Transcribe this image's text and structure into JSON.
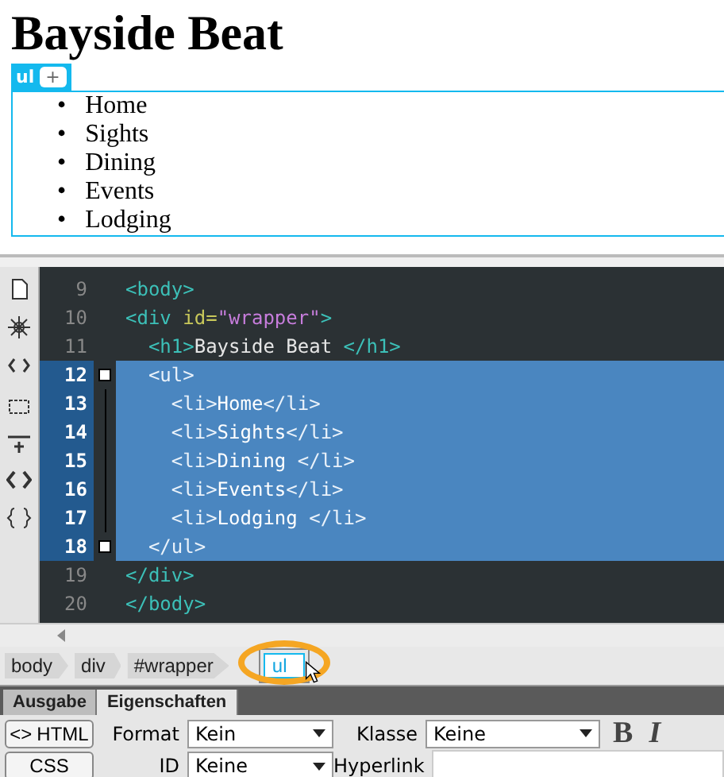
{
  "design_view": {
    "heading": "Bayside Beat",
    "tag_badge": {
      "label": "ul",
      "add": "+"
    },
    "list_items": [
      {
        "marker": "•",
        "text": "Home"
      },
      {
        "marker": "•",
        "text": "Sights"
      },
      {
        "marker": "•",
        "text": "Dining"
      },
      {
        "marker": "•",
        "text": "Events"
      },
      {
        "marker": "•",
        "text": "Lodging"
      }
    ]
  },
  "code_view": {
    "lines": [
      {
        "number": "9",
        "selected": false,
        "fold": false,
        "tokens": [
          {
            "kind": "tag",
            "text": "<body>"
          }
        ]
      },
      {
        "number": "10",
        "selected": false,
        "fold": false,
        "tokens": [
          {
            "kind": "tag",
            "text": "<div "
          },
          {
            "kind": "attr",
            "text": "id="
          },
          {
            "kind": "value",
            "text": "\"wrapper\""
          },
          {
            "kind": "tag",
            "text": ">"
          }
        ]
      },
      {
        "number": "11",
        "selected": false,
        "fold": false,
        "tokens": [
          {
            "kind": "tag",
            "text": "  <h1>"
          },
          {
            "kind": "text",
            "text": "Bayside Beat "
          },
          {
            "kind": "tag",
            "text": "</h1>"
          }
        ]
      },
      {
        "number": "12",
        "selected": true,
        "fold": true,
        "tokens": [
          {
            "kind": "tag",
            "text": "  <ul>"
          }
        ]
      },
      {
        "number": "13",
        "selected": true,
        "fold": false,
        "tokens": [
          {
            "kind": "tag",
            "text": "    <li>"
          },
          {
            "kind": "text",
            "text": "Home"
          },
          {
            "kind": "tag",
            "text": "</li>"
          }
        ]
      },
      {
        "number": "14",
        "selected": true,
        "fold": false,
        "tokens": [
          {
            "kind": "tag",
            "text": "    <li>"
          },
          {
            "kind": "text",
            "text": "Sights"
          },
          {
            "kind": "tag",
            "text": "</li>"
          }
        ]
      },
      {
        "number": "15",
        "selected": true,
        "fold": false,
        "tokens": [
          {
            "kind": "tag",
            "text": "    <li>"
          },
          {
            "kind": "text",
            "text": "Dining "
          },
          {
            "kind": "tag",
            "text": "</li>"
          }
        ]
      },
      {
        "number": "16",
        "selected": true,
        "fold": false,
        "tokens": [
          {
            "kind": "tag",
            "text": "    <li>"
          },
          {
            "kind": "text",
            "text": "Events"
          },
          {
            "kind": "tag",
            "text": "</li>"
          }
        ]
      },
      {
        "number": "17",
        "selected": true,
        "fold": false,
        "tokens": [
          {
            "kind": "tag",
            "text": "    <li>"
          },
          {
            "kind": "text",
            "text": "Lodging "
          },
          {
            "kind": "tag",
            "text": "</li>"
          }
        ]
      },
      {
        "number": "18",
        "selected": true,
        "fold": true,
        "tokens": [
          {
            "kind": "tag",
            "text": "  </ul>"
          }
        ]
      },
      {
        "number": "19",
        "selected": false,
        "fold": false,
        "tokens": [
          {
            "kind": "tag",
            "text": "</div>"
          }
        ]
      },
      {
        "number": "20",
        "selected": false,
        "fold": false,
        "tokens": [
          {
            "kind": "tag",
            "text": "</body>"
          }
        ]
      }
    ]
  },
  "breadcrumbs": [
    {
      "label": "body",
      "selected": false
    },
    {
      "label": "div",
      "selected": false
    },
    {
      "label": "#wrapper",
      "selected": false
    },
    {
      "label": "ul",
      "selected": true
    }
  ],
  "panel_tabs": [
    {
      "label": "Ausgabe",
      "selected": false
    },
    {
      "label": "Eigenschaften",
      "selected": true
    }
  ],
  "properties": {
    "html_icon": "<>",
    "html_button": "HTML",
    "css_button": "CSS",
    "format_label": "Format",
    "format_value": "Kein",
    "class_label": "Klasse",
    "class_value": "Keine",
    "bold": "B",
    "italic": "I",
    "id_label": "ID",
    "id_value": "Keine",
    "link_label": "Hyperlink"
  }
}
